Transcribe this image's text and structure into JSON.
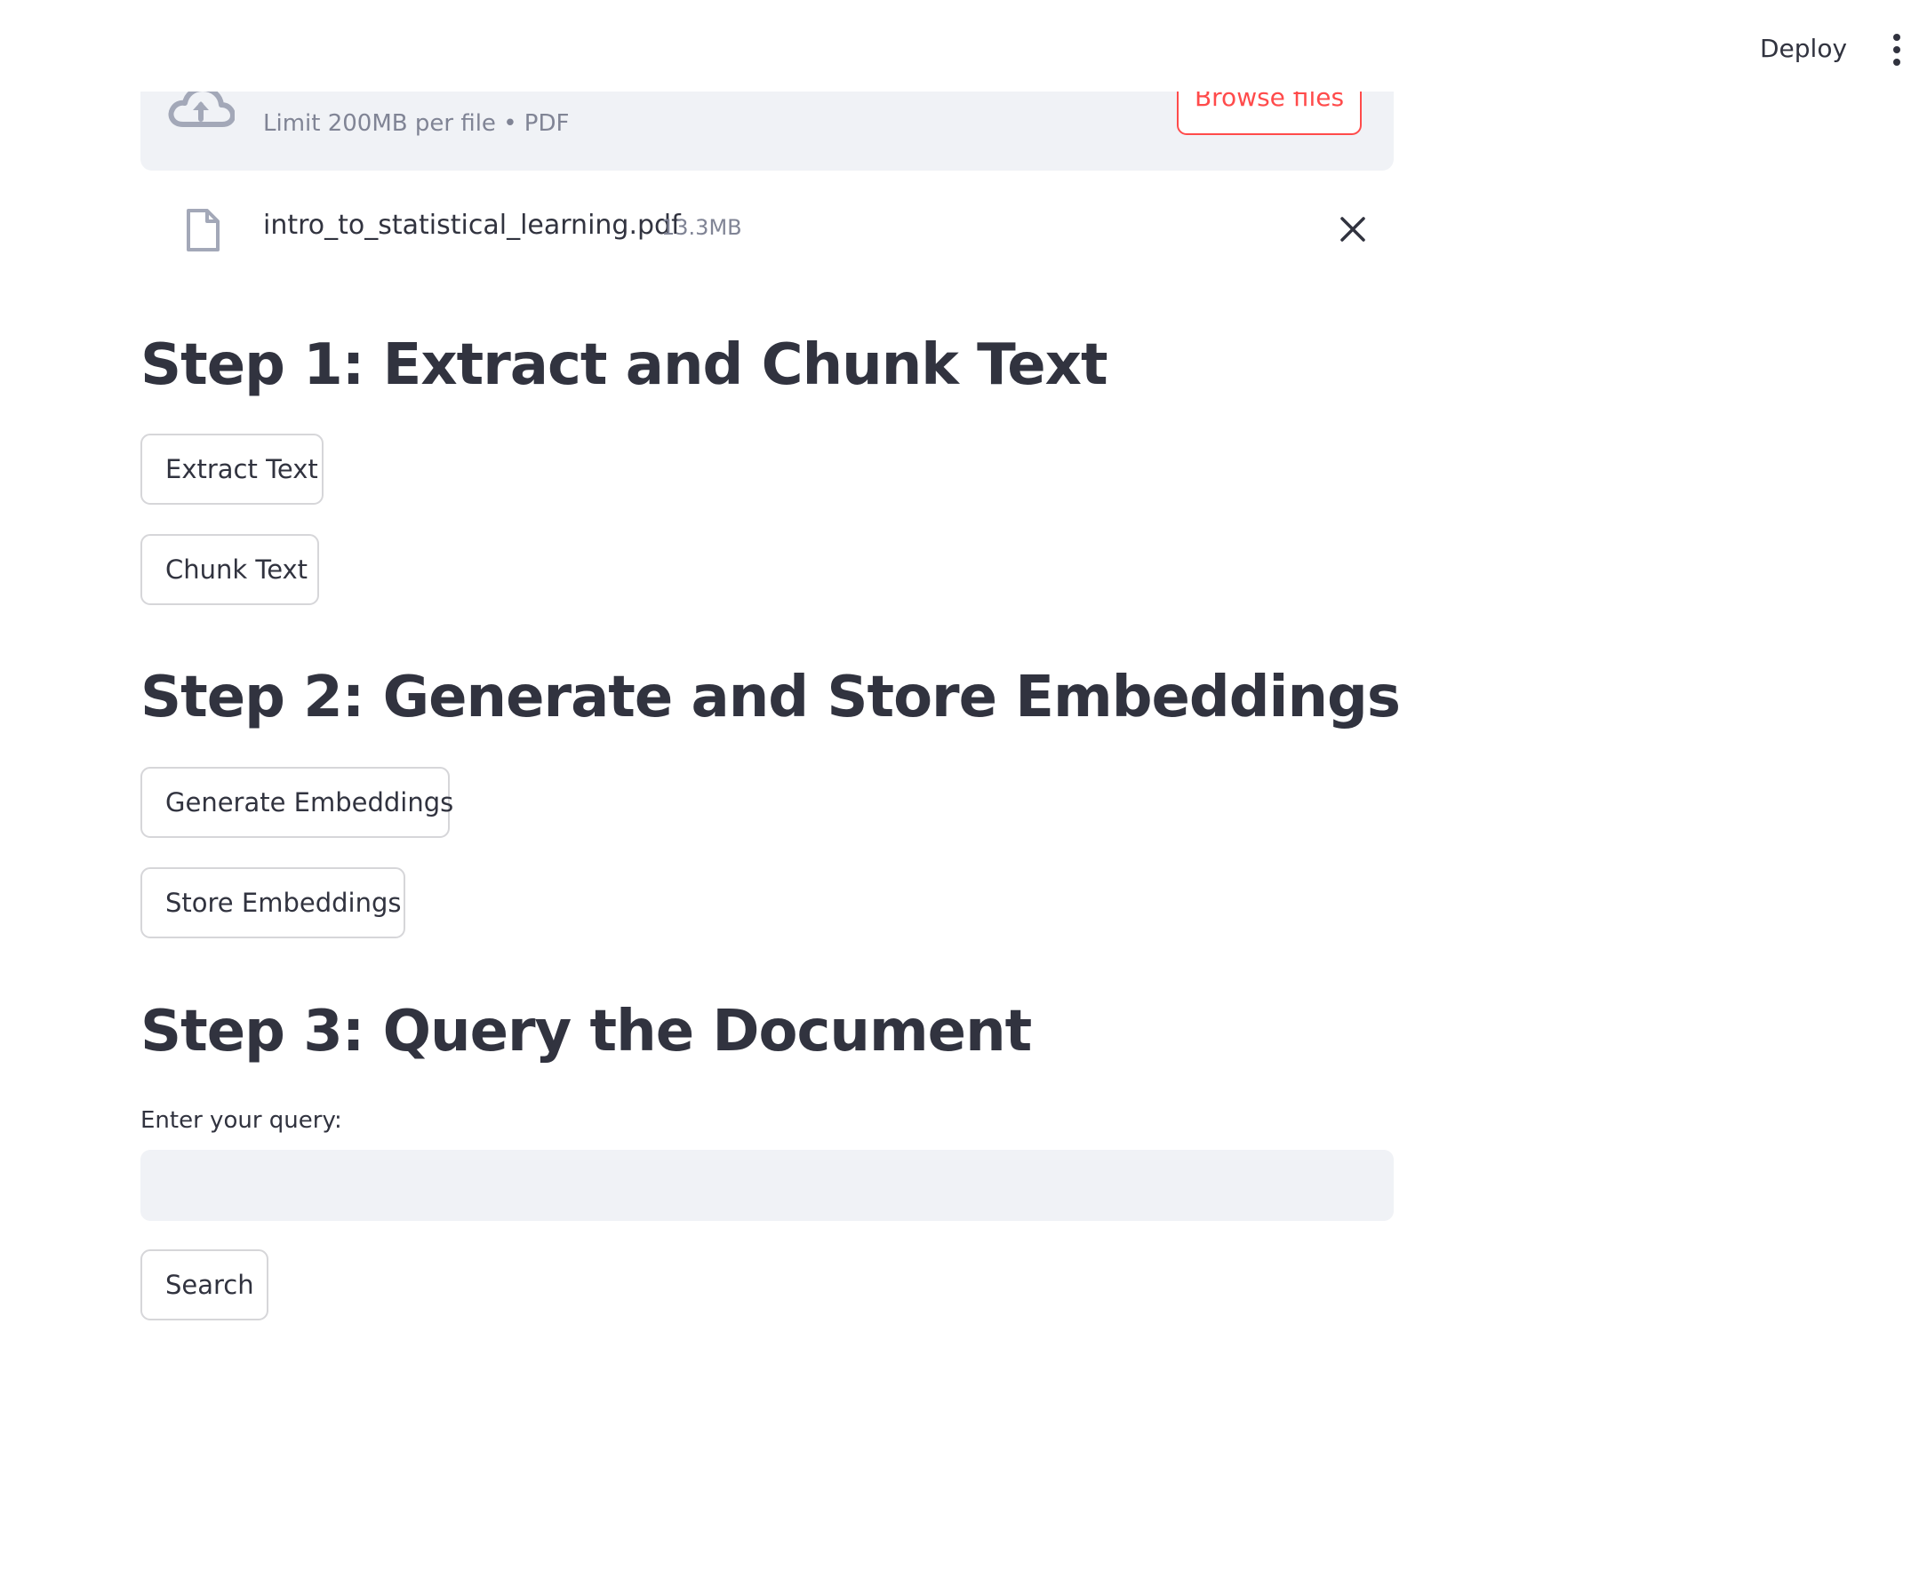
{
  "header": {
    "deploy_label": "Deploy",
    "menu_icon": "kebab-menu-icon"
  },
  "uploader": {
    "limit_text": "Limit 200MB per file • PDF",
    "browse_label": "Browse files",
    "cloud_icon": "cloud-upload-icon",
    "accent_color": "#ff4b4b"
  },
  "uploaded_file": {
    "name": "intro_to_statistical_learning.pdf",
    "size": "13.3MB",
    "file_icon": "file-icon",
    "remove_icon": "close-icon"
  },
  "step1": {
    "title": "Step 1: Extract and Chunk Text",
    "extract_label": "Extract Text",
    "chunk_label": "Chunk Text"
  },
  "step2": {
    "title": "Step 2: Generate and Store Embeddings",
    "generate_label": "Generate Embeddings",
    "store_label": "Store Embeddings"
  },
  "step3": {
    "title": "Step 3: Query the Document",
    "query_label": "Enter your query:",
    "query_value": "",
    "search_label": "Search"
  },
  "colors": {
    "text": "#31333f",
    "muted": "#808495",
    "input_bg": "#f0f2f6",
    "border": "#d6d6d9"
  }
}
